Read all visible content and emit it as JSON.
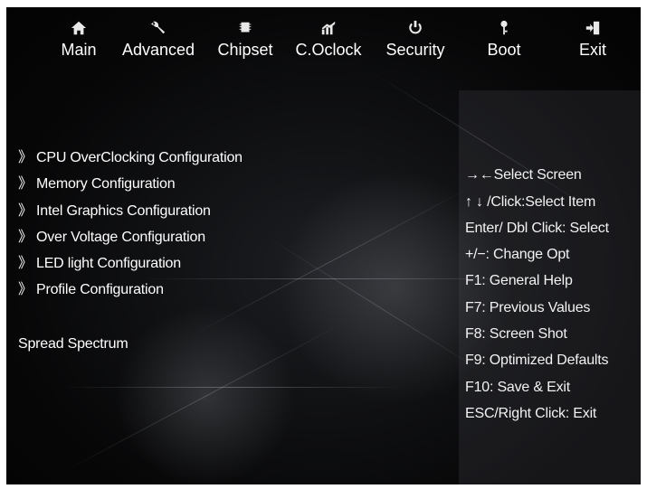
{
  "menu": {
    "items": [
      {
        "label": "Main",
        "icon": "home-icon"
      },
      {
        "label": "Advanced",
        "icon": "wrench-icon"
      },
      {
        "label": "Chipset",
        "icon": "chip-icon"
      },
      {
        "label": "C.Oclock",
        "icon": "bar-chart-icon"
      },
      {
        "label": "Security",
        "icon": "power-icon"
      },
      {
        "label": "Boot",
        "icon": "key-icon"
      },
      {
        "label": "Exit",
        "icon": "exit-icon"
      }
    ]
  },
  "config": {
    "arrow": "》",
    "items": [
      "CPU OverClocking Configuration",
      "Memory Configuration",
      "Intel Graphics Configuration",
      "Over Voltage Configuration",
      "LED light Configuration",
      "Profile Configuration"
    ],
    "spread_spectrum": "Spread Spectrum"
  },
  "help": {
    "lines": [
      "→←Select Screen",
      "↑ ↓ /Click:Select Item",
      "Enter/ Dbl Click: Select",
      "+/−: Change Opt",
      "F1: General Help",
      "F7: Previous Values",
      "F8: Screen Shot",
      "F9: Optimized Defaults",
      "F10: Save & Exit",
      "ESC/Right Click: Exit"
    ]
  },
  "colors": {
    "background": "#070708",
    "text": "#ffffff",
    "panel": "#5a5c62"
  }
}
